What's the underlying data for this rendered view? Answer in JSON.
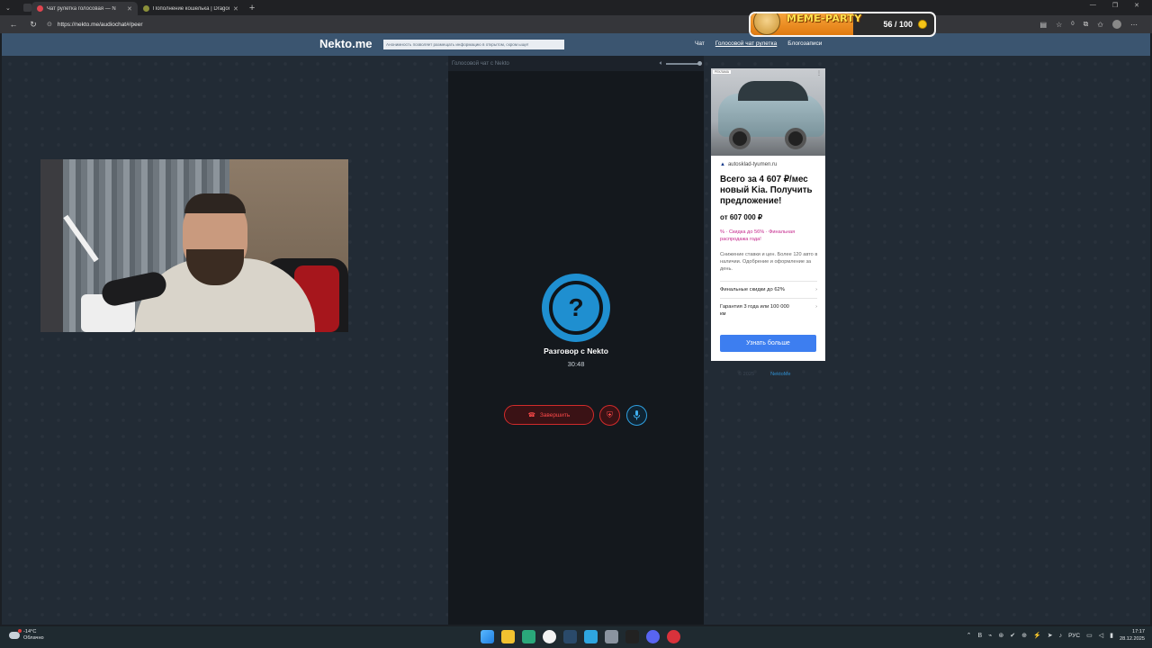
{
  "browser": {
    "tabs": [
      {
        "title": "Чат рулетка голосовая — N",
        "active": true,
        "favicon_color": "#e0454f"
      },
      {
        "title": "Пополнение кошелька | Dragon",
        "active": false,
        "favicon_color": "#8a8f3a"
      }
    ],
    "url": "https://nekto.me/audiochat#/peer",
    "toolbar_badge": "0"
  },
  "meme_party": {
    "title": "MEME-PARTY",
    "count": "56 / 100",
    "progress": 0.56
  },
  "site": {
    "logo": "Nekto.me",
    "notice": "Анонимность позволяет размещать информацию в открытом, скром ыще!",
    "nav": [
      {
        "label": "Чат",
        "active": false
      },
      {
        "label": "Голосовой чат рулетка",
        "active": true
      },
      {
        "label": "Блогозаписи",
        "active": false
      }
    ]
  },
  "chat": {
    "header_title": "Голосовой чат с Nekto",
    "volume": 1.0,
    "avatar_glyph": "?",
    "conversation_title": "Разговор с Nekto",
    "timer": "30:48",
    "end_button": "Завершить",
    "end_icon": "hangup-icon",
    "report_icon": "shield-icon",
    "mic_icon": "microphone-icon"
  },
  "ad": {
    "badge": "РЕКЛАМА",
    "domain": "autosklad-tyumen.ru",
    "headline": "Всего за 4 607 ₽/мес новый Kia. Получить предложение!",
    "price": "от 607 000 ₽",
    "promo": "% · Скидка до 56% · Финальная распродажа года!",
    "description": "Снижение ставки и цен. Более 120 авто в наличии. Одобрение и оформление за день.",
    "items": [
      {
        "label": "Финальные скидки до 62%"
      },
      {
        "label": "Гарантия 3 года или 100 000 км"
      }
    ],
    "cta": "Узнать больше",
    "footer_text": "© 2025",
    "footer_link": "NektoMe"
  },
  "taskbar": {
    "temperature": "-14°C",
    "weather": "Облачно",
    "lang": "РУС",
    "time": "17:17",
    "date": "28.12.2025",
    "apps": [
      "windows-start-icon",
      "file-explorer-icon",
      "edge-browser-icon",
      "yandex-browser-icon",
      "steam-icon",
      "telegram-icon",
      "settings-icon",
      "obs-icon",
      "discord-icon",
      "opera-icon"
    ],
    "app_colors": [
      "#3aa0f0",
      "#f2c230",
      "#2aa87a",
      "#f3f3f3",
      "#2a4a6a",
      "#2ea6e0",
      "#8a94a0",
      "#222222",
      "#5865f2",
      "#d9323b"
    ]
  }
}
